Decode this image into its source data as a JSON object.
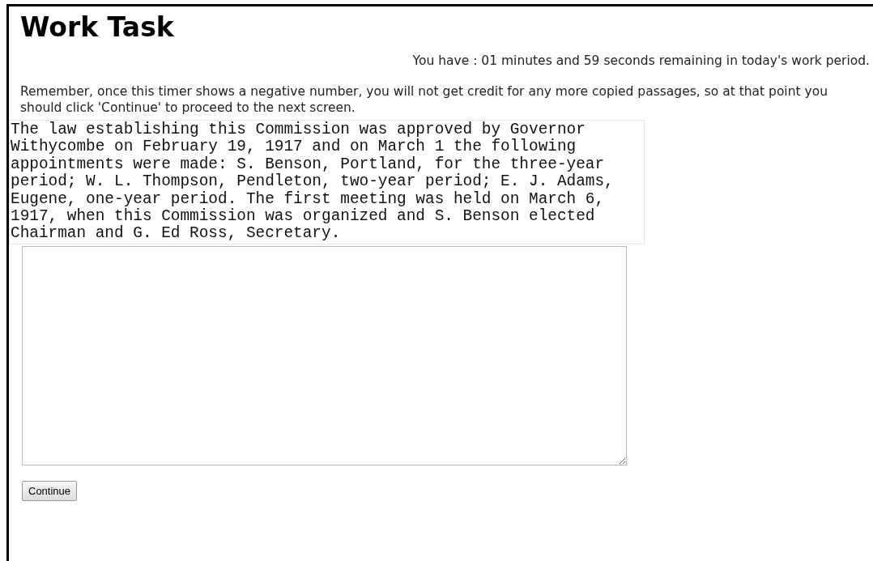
{
  "title": "Work Task",
  "timer_notice": "You have : 01 minutes and 59 seconds remaining in today's work period.",
  "instructions": "Remember, once this timer shows a negative number, you will not get credit for any more copied passages, so at that point you should click 'Continue' to proceed to the next screen.",
  "passage": "The law establishing this Commission was approved by Governor Withycombe on February 19, 1917 and on March 1 the following appointments were made: S. Benson, Portland, for the three-year period; W. L. Thompson, Pendleton, two-year period; E. J. Adams, Eugene, one-year period. The first meeting was held on March 6, 1917, when this Commission was organized and S. Benson elected Chairman and G. Ed Ross, Secretary.",
  "continue_button": "Continue"
}
